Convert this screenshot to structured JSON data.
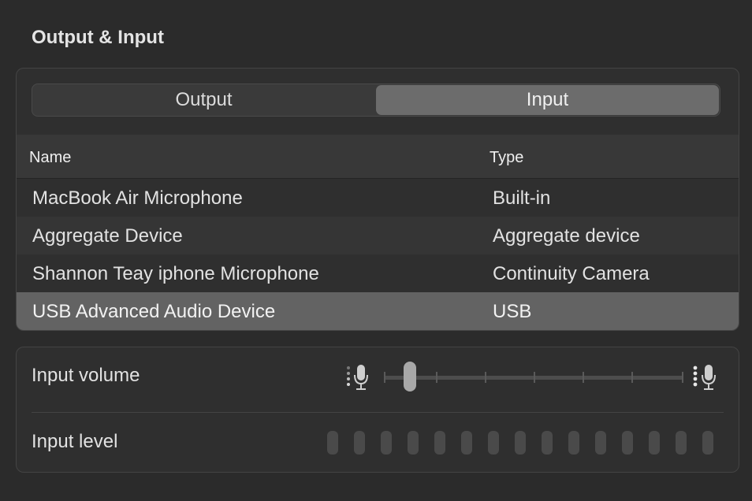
{
  "section": {
    "title": "Output & Input"
  },
  "tabs": [
    {
      "label": "Output",
      "active": false
    },
    {
      "label": "Input",
      "active": true
    }
  ],
  "table": {
    "columns": {
      "name": "Name",
      "type": "Type"
    },
    "rows": [
      {
        "name": "MacBook Air Microphone",
        "type": "Built-in",
        "selected": false
      },
      {
        "name": "Aggregate Device",
        "type": "Aggregate device",
        "selected": false
      },
      {
        "name": "Shannon Teay iphone Microphone",
        "type": "Continuity Camera",
        "selected": false
      },
      {
        "name": "USB Advanced Audio Device",
        "type": "USB",
        "selected": true
      }
    ]
  },
  "volume": {
    "label": "Input volume",
    "level_fraction": 0.07,
    "low_icon": "microphone-low-icon",
    "high_icon": "microphone-high-icon"
  },
  "level": {
    "label": "Input level",
    "segments_total": 15,
    "segments_lit": 0
  },
  "colors": {
    "background": "#2b2b2b",
    "selected_row": "#636363",
    "active_tab": "#6c6c6c"
  }
}
